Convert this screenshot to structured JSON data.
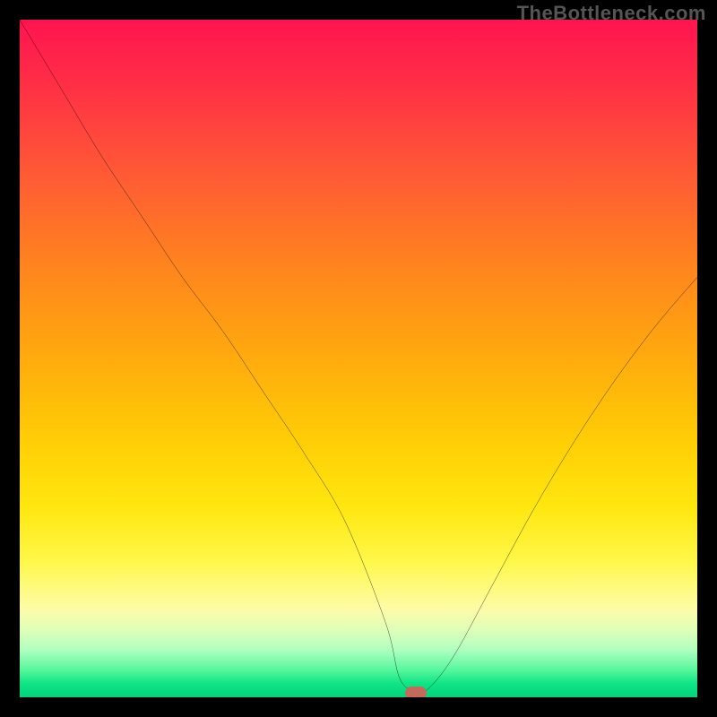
{
  "watermark": "TheBottleneck.com",
  "chart_data": {
    "type": "line",
    "title": "",
    "xlabel": "",
    "ylabel": "",
    "xlim": [
      0,
      100
    ],
    "ylim": [
      0,
      100
    ],
    "series": [
      {
        "name": "curve",
        "x": [
          0,
          6,
          12,
          18,
          24,
          30,
          36,
          42,
          48,
          54,
          56,
          58,
          60,
          64,
          70,
          76,
          82,
          88,
          94,
          100
        ],
        "y": [
          100,
          90,
          80,
          71,
          62,
          54,
          45,
          36,
          26,
          11,
          3,
          1,
          1,
          6,
          17,
          28,
          38,
          47,
          55,
          62
        ]
      }
    ],
    "marker": {
      "x": 58.5,
      "y": 0.6
    },
    "gradient_note": "background encodes bottleneck severity: red (top) = bad, green (bottom) = good"
  }
}
